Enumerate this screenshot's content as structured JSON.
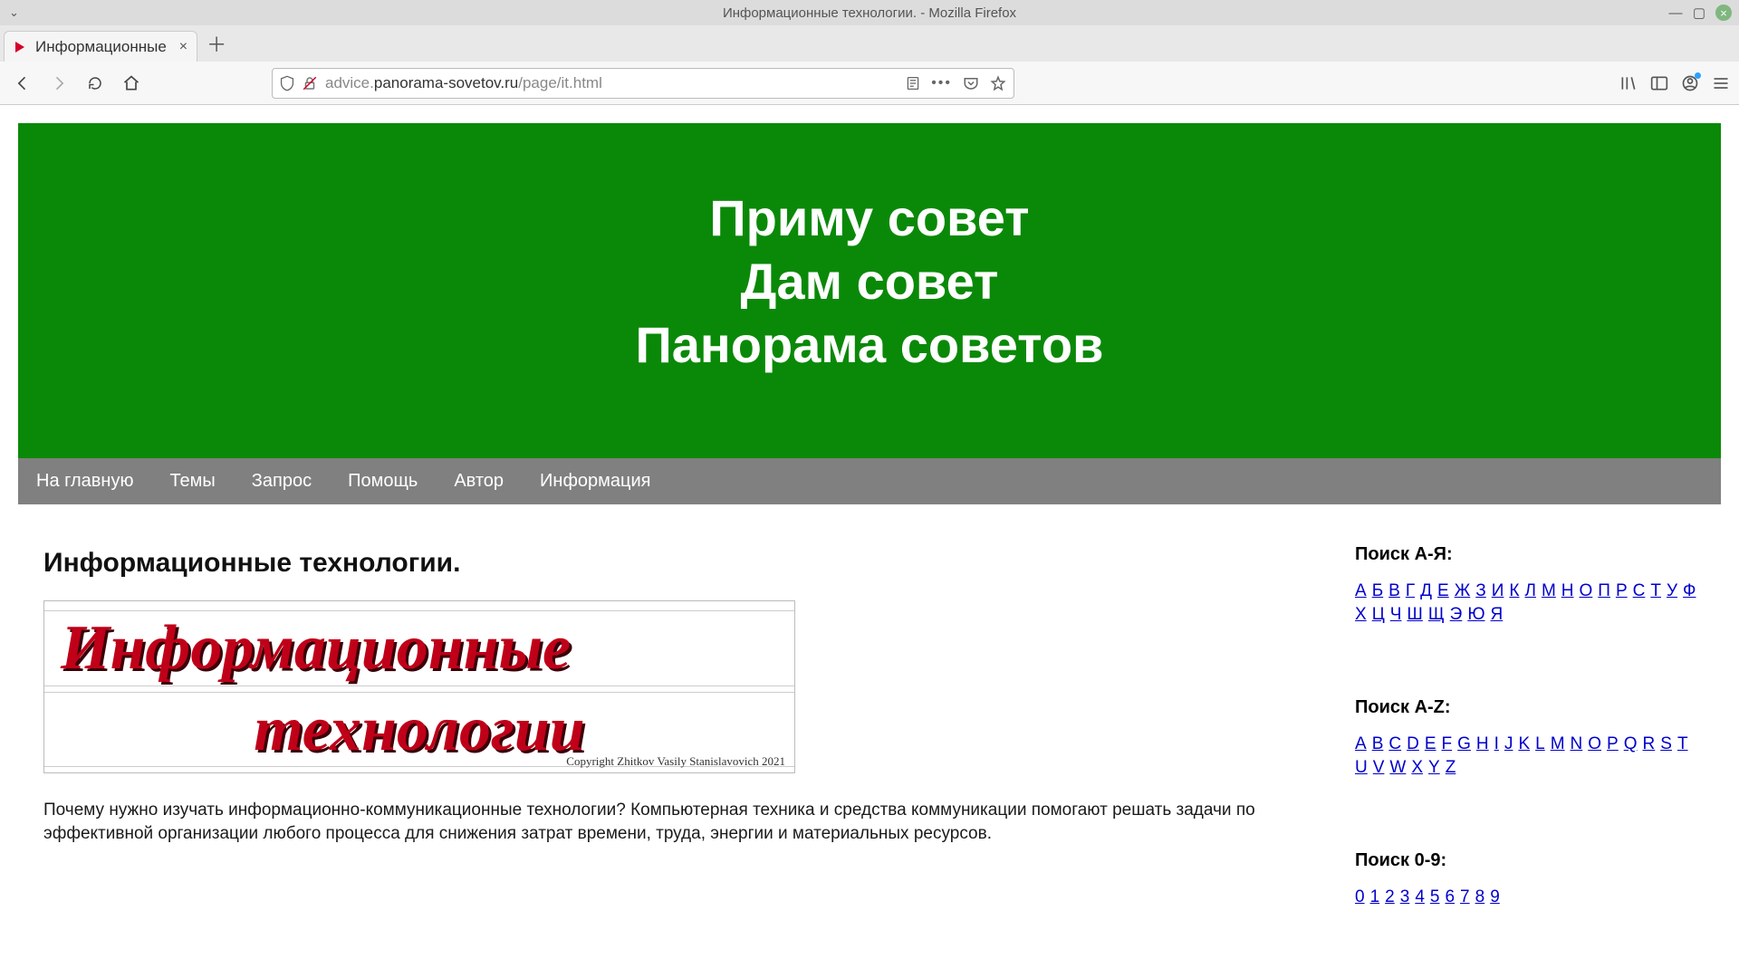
{
  "window": {
    "title": "Информационные технологии. - Mozilla Firefox"
  },
  "tab": {
    "title": "Информационные"
  },
  "url": {
    "prefix": "advice.",
    "domain": "panorama-sovetov.ru",
    "path": "/page/it.html"
  },
  "hero": {
    "line1": "Приму совет",
    "line2": "Дам совет",
    "line3": "Панорама советов"
  },
  "menu": [
    "На главную",
    "Темы",
    "Запрос",
    "Помощь",
    "Автор",
    "Информация"
  ],
  "article": {
    "heading": "Информационные технологии.",
    "banner_line1": "Информационные",
    "banner_line2": "технологии",
    "banner_copyright": "Copyright  Zhitkov Vasily Stanislavovich 2021",
    "body": "Почему нужно изучать информационно-коммуникационные технологии? Компьютерная техника и средства коммуникации помогают решать задачи по эффективной организации любого процесса для снижения затрат времени, труда, энергии и материальных ресурсов."
  },
  "sidebar": {
    "search_cyr_title": "Поиск А-Я:",
    "cyr": [
      "А",
      "Б",
      "В",
      "Г",
      "Д",
      "Е",
      "Ж",
      "З",
      "И",
      "К",
      "Л",
      "М",
      "Н",
      "О",
      "П",
      "Р",
      "С",
      "Т",
      "У",
      "Ф",
      "Х",
      "Ц",
      "Ч",
      "Ш",
      "Щ",
      "Э",
      "Ю",
      "Я"
    ],
    "search_lat_title": "Поиск A-Z:",
    "lat": [
      "A",
      "B",
      "C",
      "D",
      "E",
      "F",
      "G",
      "H",
      "I",
      "J",
      "K",
      "L",
      "M",
      "N",
      "O",
      "P",
      "Q",
      "R",
      "S",
      "T",
      "U",
      "V",
      "W",
      "X",
      "Y",
      "Z"
    ],
    "search_num_title": "Поиск 0-9:",
    "num": [
      "0",
      "1",
      "2",
      "3",
      "4",
      "5",
      "6",
      "7",
      "8",
      "9"
    ]
  }
}
